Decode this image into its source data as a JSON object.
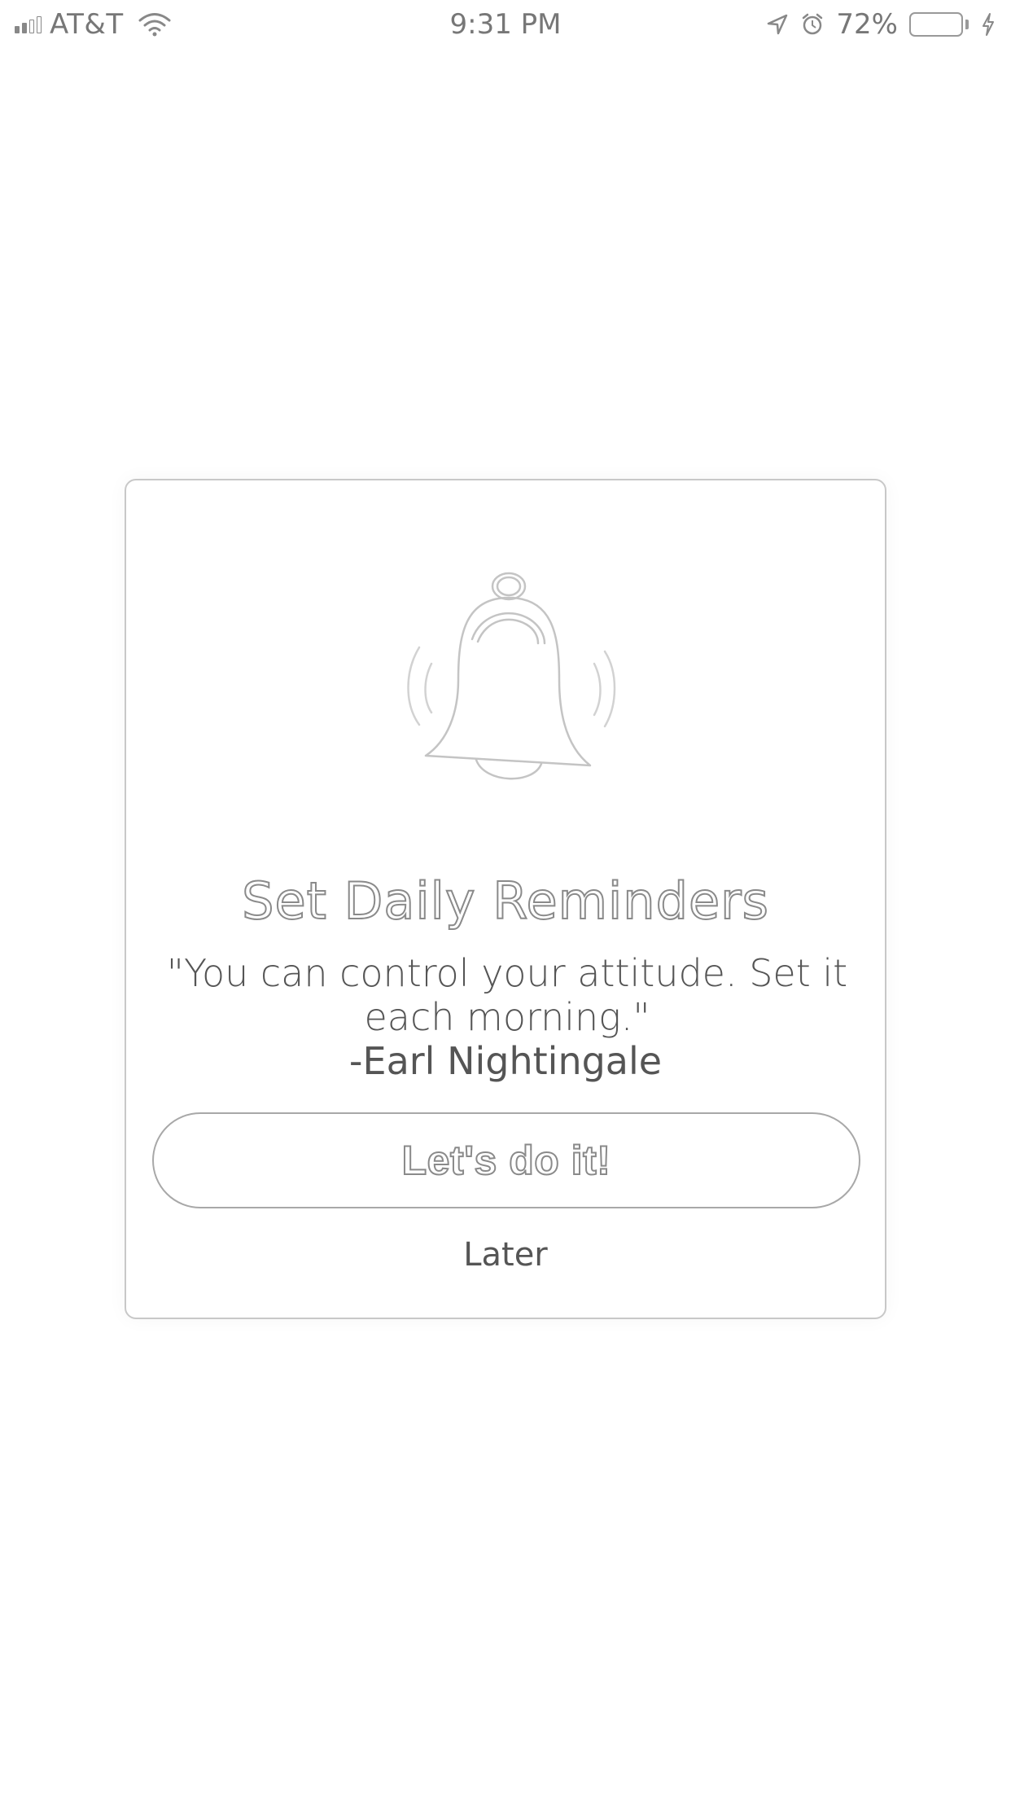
{
  "status_bar": {
    "carrier": "AT&T",
    "time": "9:31 PM",
    "battery_percent": "72%",
    "battery_level": 0.72,
    "icons": [
      "signal-icon",
      "wifi-icon",
      "location-icon",
      "alarm-icon",
      "battery-icon",
      "charging-icon"
    ]
  },
  "modal": {
    "icon": "bell-icon",
    "title": "Set Daily Reminders",
    "quote": "\"You can control your attitude. Set it each morning.\"",
    "author": "-Earl Nightingale",
    "primary_button": "Let's do it!",
    "secondary_button": "Later"
  },
  "colors": {
    "background": "#ffffff",
    "border": "#c8c8c8",
    "text": "#555555",
    "outline_text": "#8a8a8a"
  }
}
